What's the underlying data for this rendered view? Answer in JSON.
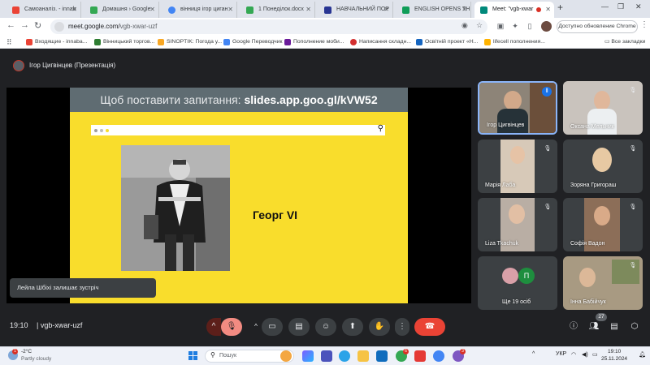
{
  "browser": {
    "tabs": [
      {
        "label": "Самоаналіз. - innab",
        "icon": "gmail-icon",
        "color": "#ea4335"
      },
      {
        "label": "Домашня › Google",
        "icon": "drive-icon",
        "color": "#34a853"
      },
      {
        "label": "вінниця ігор циган",
        "icon": "google-icon",
        "color": "#4285f4"
      },
      {
        "label": "1 Понеділок.docx",
        "icon": "drive-icon",
        "color": "#34a853"
      },
      {
        "label": "НАВЧАЛЬНИЙ ПОР",
        "icon": "docs-icon",
        "color": "#283593"
      },
      {
        "label": "ENGLISH OPENS TH",
        "icon": "document-icon",
        "color": "#0f9d58"
      },
      {
        "label": "Meet: \"vgb-xwar",
        "icon": "meet-icon",
        "color": "#00897b",
        "active": true
      }
    ],
    "url_host": "meet.google.com/",
    "url_path": "vgb-xwar-uzf",
    "update_button": "Доступно обновление Chrome",
    "bookmarks": [
      {
        "label": "Входящие - innaba...",
        "color": "#ea4335"
      },
      {
        "label": "Вінницький торгов...",
        "color": "#2e7d32"
      },
      {
        "label": "SINOPTIK: Погода у...",
        "color": "#f9a825"
      },
      {
        "label": "Google Переводчик",
        "color": "#4285f4"
      },
      {
        "label": "Пополнение моби...",
        "color": "#6a1b9a"
      },
      {
        "label": "Написання складн...",
        "color": "#d32f2f"
      },
      {
        "label": "Освітній проект «Н...",
        "color": "#1565c0"
      },
      {
        "label": "lifecell пополнения...",
        "color": "#ffb300"
      }
    ],
    "all_bookmarks": "Все закладки"
  },
  "meet": {
    "presenter_label": "Ігор Цигвінцев (Презентація)",
    "slide": {
      "banner_prefix": "Щоб поставити запитання:",
      "banner_link": "slides.app.goo.gl/kVW52",
      "caption": "Георг VI"
    },
    "toast": "Лейла Шбіхі залишає зустріч",
    "participants": [
      {
        "name": "Ігор Цигвінцев",
        "speaking": true
      },
      {
        "name": "Оксана Мельник"
      },
      {
        "name": "Марія Лаба"
      },
      {
        "name": "Зоряна Григораш"
      },
      {
        "name": "Liza Tkachuk"
      },
      {
        "name": "Софія Вадон"
      },
      {
        "name": "Ще 19 осіб",
        "initial": "П"
      },
      {
        "name": "Інна Бабійчук"
      }
    ],
    "time": "19:10",
    "meeting_code": "vgb-xwar-uzf",
    "people_count": "27"
  },
  "taskbar": {
    "weather_temp": "-2°C",
    "weather_desc": "Partly cloudy",
    "weather_badge": "1",
    "search_placeholder": "Пошук",
    "language": "УКР",
    "clock_time": "19:10",
    "clock_date": "25.11.2024",
    "badge_one": "6",
    "badge_two": "3"
  }
}
